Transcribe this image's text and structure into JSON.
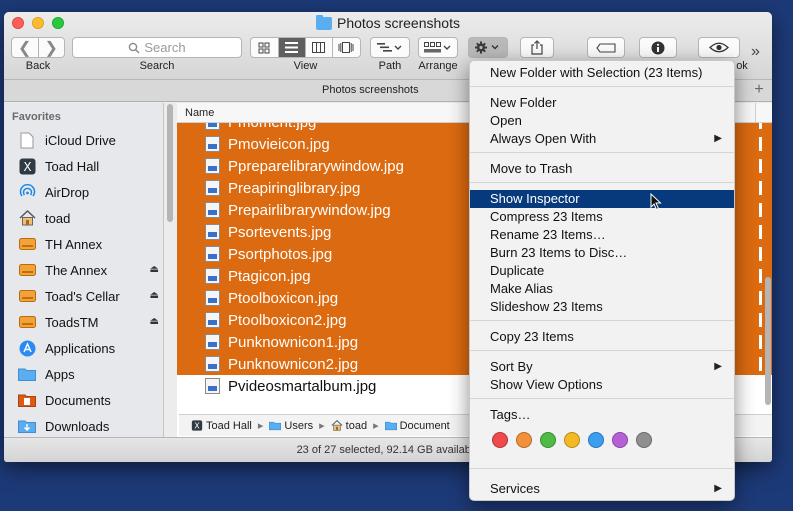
{
  "window": {
    "title": "Photos screenshots",
    "tab_title": "Photos screenshots",
    "status": "23 of 27 selected, 92.14 GB available"
  },
  "toolbar": {
    "back_label": "Back",
    "search_label": "Search",
    "search_placeholder": "Search",
    "view_label": "View",
    "path_label": "Path",
    "arrange_label": "Arrange",
    "quicklook_partial": "ok",
    "overflow": "»"
  },
  "sidebar": {
    "heading": "Favorites",
    "items": [
      {
        "label": "iCloud Drive",
        "icon": "document-icon"
      },
      {
        "label": "Toad Hall",
        "icon": "disk-icon"
      },
      {
        "label": "AirDrop",
        "icon": "airdrop-icon"
      },
      {
        "label": "toad",
        "icon": "home-icon"
      },
      {
        "label": "TH Annex",
        "icon": "drive-icon"
      },
      {
        "label": "The Annex",
        "icon": "drive-icon",
        "eject": true
      },
      {
        "label": "Toad's Cellar",
        "icon": "drive-icon",
        "eject": true
      },
      {
        "label": "ToadsTM",
        "icon": "drive-icon",
        "eject": true
      },
      {
        "label": "Applications",
        "icon": "applications-icon"
      },
      {
        "label": "Apps",
        "icon": "folder-icon"
      },
      {
        "label": "Documents",
        "icon": "documents-icon"
      },
      {
        "label": "Downloads",
        "icon": "downloads-icon"
      }
    ]
  },
  "list": {
    "column_name": "Name",
    "files": [
      {
        "name": "Pmoment.jpg",
        "selected": true
      },
      {
        "name": "Pmovieicon.jpg",
        "selected": true
      },
      {
        "name": "Ppreparelibrarywindow.jpg",
        "selected": true
      },
      {
        "name": "Preapiringlibrary.jpg",
        "selected": true
      },
      {
        "name": "Prepairlibrarywindow.jpg",
        "selected": true
      },
      {
        "name": "Psortevents.jpg",
        "selected": true
      },
      {
        "name": "Psortphotos.jpg",
        "selected": true
      },
      {
        "name": "Ptagicon.jpg",
        "selected": true
      },
      {
        "name": "Ptoolboxicon.jpg",
        "selected": true
      },
      {
        "name": "Ptoolboxicon2.jpg",
        "selected": true
      },
      {
        "name": "Punknownicon1.jpg",
        "selected": true
      },
      {
        "name": "Punknownicon2.jpg",
        "selected": true
      },
      {
        "name": "Pvideosmartalbum.jpg",
        "selected": false
      }
    ]
  },
  "pathbar": {
    "items": [
      "Toad Hall",
      "Users",
      "toad",
      "Document"
    ],
    "separator": "▸"
  },
  "context_menu": {
    "items": [
      {
        "label": "New Folder with Selection (23 Items)"
      },
      {
        "label": "New Folder"
      },
      {
        "label": "Open"
      },
      {
        "label": "Always Open With",
        "submenu": true
      },
      {
        "label": "Move to Trash"
      },
      {
        "label": "Show Inspector",
        "highlighted": true
      },
      {
        "label": "Compress 23 Items"
      },
      {
        "label": "Rename 23 Items…"
      },
      {
        "label": "Burn 23 Items to Disc…"
      },
      {
        "label": "Duplicate"
      },
      {
        "label": "Make Alias"
      },
      {
        "label": "Slideshow 23 Items"
      },
      {
        "label": "Copy 23 Items"
      },
      {
        "label": "Sort By",
        "submenu": true
      },
      {
        "label": "Show View Options"
      },
      {
        "label": "Tags…"
      },
      {
        "label": "Services",
        "submenu": true
      }
    ],
    "tag_colors": [
      "#f0494c",
      "#f2913a",
      "#4dbb46",
      "#f5b825",
      "#3c9ef0",
      "#b660d8",
      "#8f8f8f"
    ],
    "submenu_arrow": "▶"
  },
  "colors": {
    "selection": "#dc6a10",
    "menu_highlight": "#073a7c",
    "desktop": "#1d3a78"
  }
}
